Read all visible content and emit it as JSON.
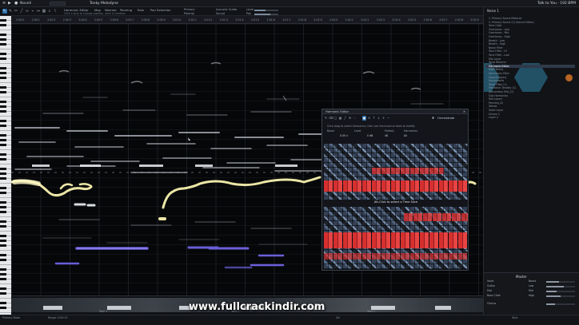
{
  "titlebar": {
    "project_label": "Noveli",
    "song_title": "Tonky Melodyne",
    "window_title": "Talk to You - 192 BPM"
  },
  "toolbar": {
    "buttons": [
      "Harmonic Editor",
      "Map",
      "Warmer",
      "Panning",
      "Rain",
      "Pan Selection"
    ],
    "hint": "Click a strip to change position, pitch & duration",
    "fields": {
      "mode_label": "Primary",
      "polarity_label": "Polarity",
      "scale_label": "Acoustic Guitar",
      "sound_label": "Sound",
      "level_label": "Level",
      "pan_label": "Pan"
    }
  },
  "ruler": {
    "ticks": [
      "2:00:0",
      "2:00:1",
      "2:00:2",
      "2:00:3",
      "2:00:4",
      "2:00:5",
      "2:00:6",
      "2:00:7",
      "2:00:8",
      "2:00:9",
      "2:01:0",
      "2:01:1",
      "2:01:2",
      "2:01:3",
      "2:01:4",
      "2:01:5",
      "2:01:6",
      "2:01:7",
      "2:01:8",
      "2:01:9",
      "2:02:0",
      "2:02:1",
      "2:02:2",
      "2:02:3",
      "2:02:4",
      "2:02:5",
      "2:02:6",
      "2:02:7",
      "2:02:8",
      "2:02:9"
    ]
  },
  "harmonic_editor": {
    "title": "Harmonic Editor",
    "orchestrate_label": "Orchestrate",
    "hint": "Click-drag to select harmonics, then use the brush or tools to modify",
    "params": [
      {
        "label": "Boost",
        "value": "0.00 x"
      },
      {
        "label": "Level",
        "value": "0 dB"
      },
      {
        "label": "Partials",
        "value": "48"
      },
      {
        "label": "Harmonics",
        "value": "All"
      }
    ],
    "overlay_message": "Alt-Click to select a Time Slice"
  },
  "panel": {
    "title": "Noise 1",
    "items": [
      "1. Primary Sound Material",
      "2. Primary Sound (2) (Sound Editor)",
      "Tone Color",
      "Overtones - Low",
      "Overtones - Mid",
      "Overtones - High",
      "Breath - Low",
      "Breath - High",
      "Noise Filter",
      "Tone Filter - Hi",
      "Tone Filter - Low",
      "Mix Layer",
      "Tonal Balance",
      "Harmonic Editor",
      "Main Tonics",
      "Harmonics Filter",
      "[Sound Layer]",
      "Instruments",
      "Tonal Filter (1)",
      "Harmonic Tonality (1)",
      "[Secondary Mix] (2)",
      "Sub-Harmonics",
      "Mid Layers",
      "Panning (2)",
      "Stereo",
      "Voice Layer",
      "Unison 1",
      "Layer 2"
    ],
    "selected_index": 13,
    "mixer": {
      "header": "Master",
      "rows": [
        {
          "label": "Voice",
          "level": 0.45
        },
        {
          "label": "Guitar",
          "level": 0.6
        },
        {
          "label": "Pad",
          "level": 0.35
        },
        {
          "label": "Bass Choir",
          "level": 0.5
        },
        {
          "label": "Chorus",
          "level": 0.3
        }
      ],
      "eq": [
        {
          "label": "Boost",
          "level": 0.55
        },
        {
          "label": "Low",
          "level": 0.4
        },
        {
          "label": "Mid",
          "level": 0.6
        },
        {
          "label": "High",
          "level": 0.5
        }
      ]
    }
  },
  "overview": {
    "labels": [
      "Take 1",
      "Take 2",
      "Take 3"
    ]
  },
  "status": {
    "left": "Primary Mode",
    "pos": "Range: 0:00:15",
    "right_a": "Sel",
    "right_b": "Tonic"
  },
  "watermark": "www.fullcrackindir.com",
  "colors": {
    "accent": "#2d6fa8",
    "note_yellow": "#e8e2a0",
    "note_purple": "#6a5fd8",
    "spectrum_red": "#d62f2f"
  }
}
